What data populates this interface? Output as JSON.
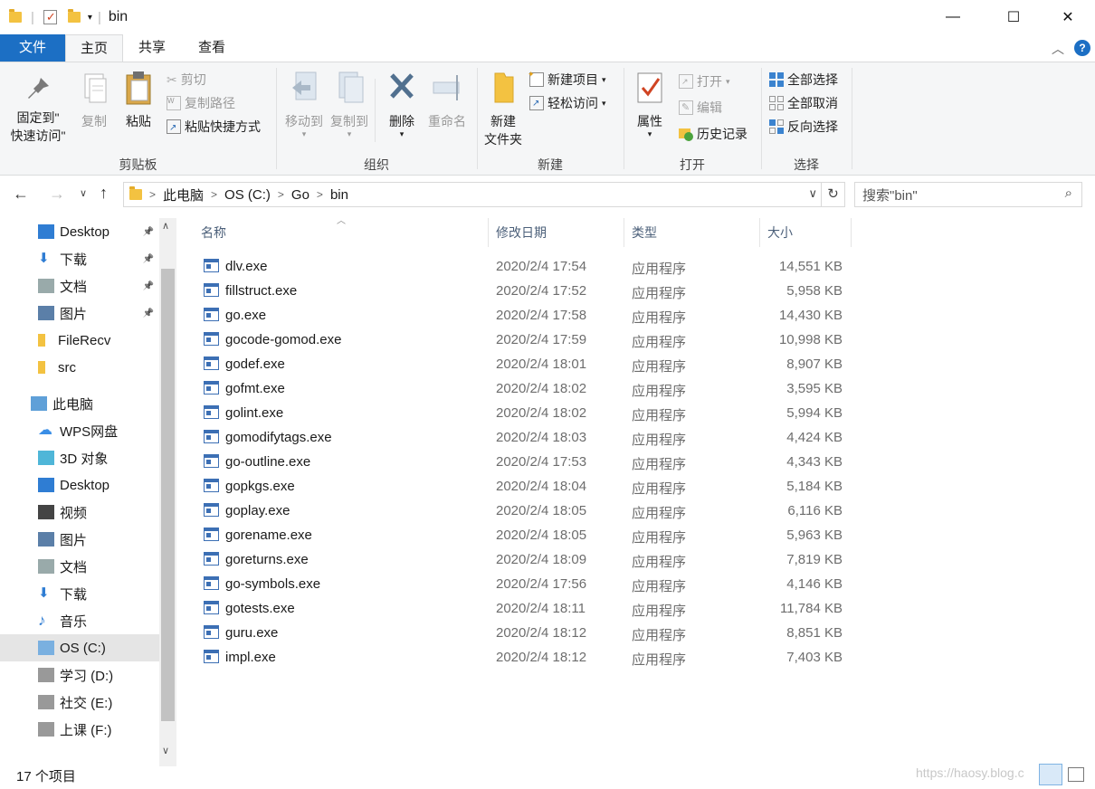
{
  "window": {
    "title": "bin",
    "min_icon": "—",
    "max_icon": "☐",
    "close_icon": "✕"
  },
  "tabs": {
    "file": "文件",
    "home": "主页",
    "share": "共享",
    "view": "查看"
  },
  "ribbon": {
    "clipboard": {
      "label": "剪贴板",
      "pin_line1": "固定到\"",
      "pin_line2": "快速访问\"",
      "copy": "复制",
      "paste": "粘贴",
      "cut": "剪切",
      "copy_path": "复制路径",
      "paste_shortcut": "粘贴快捷方式"
    },
    "organize": {
      "label": "组织",
      "move_to": "移动到",
      "copy_to": "复制到",
      "delete": "删除",
      "rename": "重命名"
    },
    "new": {
      "label": "新建",
      "new_folder_line1": "新建",
      "new_folder_line2": "文件夹",
      "new_item": "新建项目",
      "easy_access": "轻松访问"
    },
    "open": {
      "label": "打开",
      "properties": "属性",
      "open": "打开",
      "edit": "编辑",
      "history": "历史记录"
    },
    "select": {
      "label": "选择",
      "select_all": "全部选择",
      "select_none": "全部取消",
      "invert": "反向选择"
    }
  },
  "address": {
    "crumbs": [
      "此电脑",
      "OS (C:)",
      "Go",
      "bin"
    ],
    "search_placeholder": "搜索\"bin\""
  },
  "sidebar": {
    "items": [
      {
        "label": "Desktop",
        "pinned": true
      },
      {
        "label": "下载",
        "pinned": true
      },
      {
        "label": "文档",
        "pinned": true
      },
      {
        "label": "图片",
        "pinned": true
      },
      {
        "label": "FileRecv",
        "pinned": false
      },
      {
        "label": "src",
        "pinned": false
      },
      {
        "label": "此电脑",
        "pinned": false
      },
      {
        "label": "WPS网盘",
        "pinned": false
      },
      {
        "label": "3D 对象",
        "pinned": false
      },
      {
        "label": "Desktop",
        "pinned": false
      },
      {
        "label": "视频",
        "pinned": false
      },
      {
        "label": "图片",
        "pinned": false
      },
      {
        "label": "文档",
        "pinned": false
      },
      {
        "label": "下载",
        "pinned": false
      },
      {
        "label": "音乐",
        "pinned": false
      },
      {
        "label": "OS (C:)",
        "pinned": false
      },
      {
        "label": "学习 (D:)",
        "pinned": false
      },
      {
        "label": "社交 (E:)",
        "pinned": false
      },
      {
        "label": "上课 (F:)",
        "pinned": false
      }
    ]
  },
  "columns": {
    "name": "名称",
    "date": "修改日期",
    "type": "类型",
    "size": "大小"
  },
  "files": [
    {
      "name": "dlv.exe",
      "date": "2020/2/4 17:54",
      "type": "应用程序",
      "size": "14,551 KB"
    },
    {
      "name": "fillstruct.exe",
      "date": "2020/2/4 17:52",
      "type": "应用程序",
      "size": "5,958 KB"
    },
    {
      "name": "go.exe",
      "date": "2020/2/4 17:58",
      "type": "应用程序",
      "size": "14,430 KB"
    },
    {
      "name": "gocode-gomod.exe",
      "date": "2020/2/4 17:59",
      "type": "应用程序",
      "size": "10,998 KB"
    },
    {
      "name": "godef.exe",
      "date": "2020/2/4 18:01",
      "type": "应用程序",
      "size": "8,907 KB"
    },
    {
      "name": "gofmt.exe",
      "date": "2020/2/4 18:02",
      "type": "应用程序",
      "size": "3,595 KB"
    },
    {
      "name": "golint.exe",
      "date": "2020/2/4 18:02",
      "type": "应用程序",
      "size": "5,994 KB"
    },
    {
      "name": "gomodifytags.exe",
      "date": "2020/2/4 18:03",
      "type": "应用程序",
      "size": "4,424 KB"
    },
    {
      "name": "go-outline.exe",
      "date": "2020/2/4 17:53",
      "type": "应用程序",
      "size": "4,343 KB"
    },
    {
      "name": "gopkgs.exe",
      "date": "2020/2/4 18:04",
      "type": "应用程序",
      "size": "5,184 KB"
    },
    {
      "name": "goplay.exe",
      "date": "2020/2/4 18:05",
      "type": "应用程序",
      "size": "6,116 KB"
    },
    {
      "name": "gorename.exe",
      "date": "2020/2/4 18:05",
      "type": "应用程序",
      "size": "5,963 KB"
    },
    {
      "name": "goreturns.exe",
      "date": "2020/2/4 18:09",
      "type": "应用程序",
      "size": "7,819 KB"
    },
    {
      "name": "go-symbols.exe",
      "date": "2020/2/4 17:56",
      "type": "应用程序",
      "size": "4,146 KB"
    },
    {
      "name": "gotests.exe",
      "date": "2020/2/4 18:11",
      "type": "应用程序",
      "size": "11,784 KB"
    },
    {
      "name": "guru.exe",
      "date": "2020/2/4 18:12",
      "type": "应用程序",
      "size": "8,851 KB"
    },
    {
      "name": "impl.exe",
      "date": "2020/2/4 18:12",
      "type": "应用程序",
      "size": "7,403 KB"
    }
  ],
  "status": {
    "count": "17 个项目",
    "watermark": "https://haosy.blog.c"
  },
  "colors": {
    "accent": "#1c6fc4",
    "selected": "#e5e5e5"
  }
}
